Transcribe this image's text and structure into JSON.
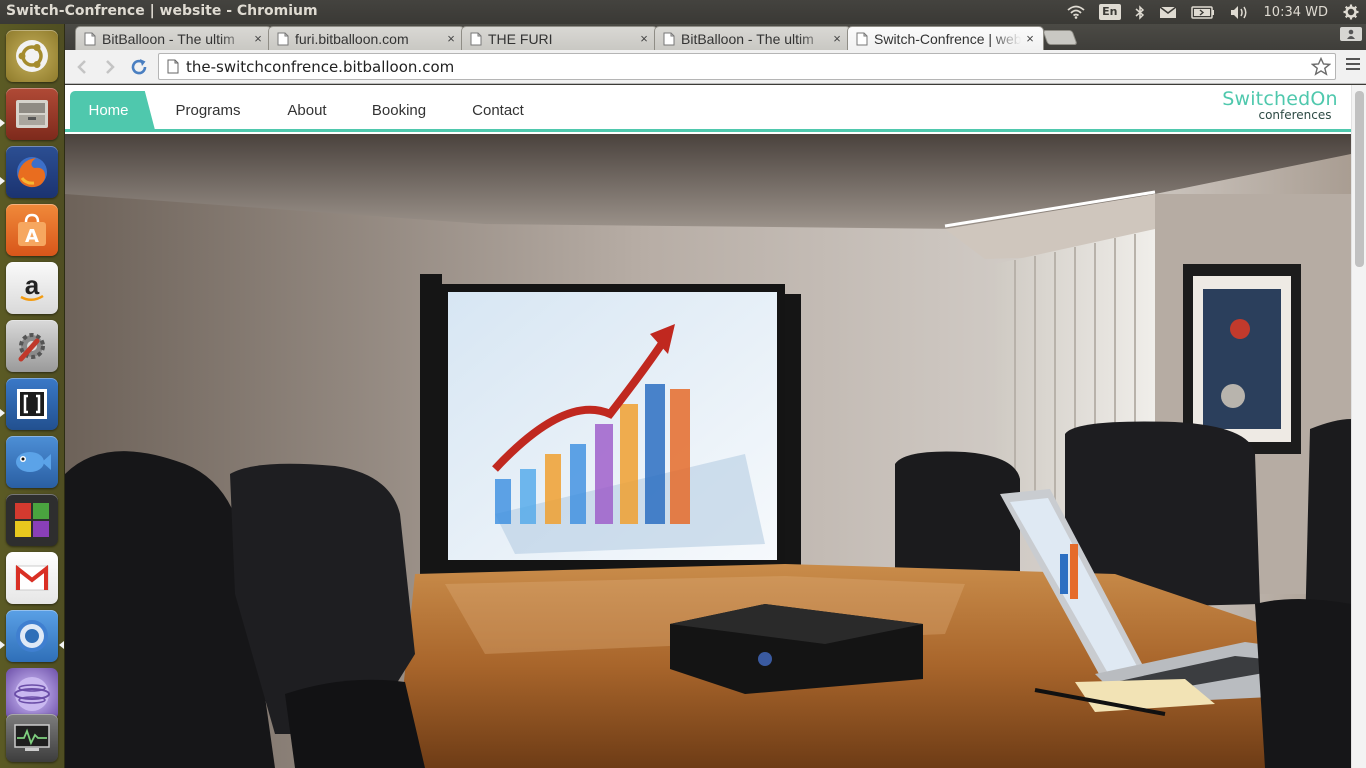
{
  "top_panel": {
    "window_title": "Switch-Confrence | website - Chromium",
    "keyboard_layout": "En",
    "clock": "10:34 WD",
    "indicators": [
      "wifi-icon",
      "bluetooth-icon",
      "mail-icon",
      "battery-icon",
      "volume-icon",
      "power-gear-icon"
    ]
  },
  "launcher": {
    "items": [
      {
        "name": "ubuntu-dash-icon"
      },
      {
        "name": "files-icon"
      },
      {
        "name": "firefox-icon"
      },
      {
        "name": "software-center-icon"
      },
      {
        "name": "amazon-icon"
      },
      {
        "name": "system-settings-icon"
      },
      {
        "name": "brackets-icon"
      },
      {
        "name": "fish-app-icon"
      },
      {
        "name": "workspaces-icon"
      },
      {
        "name": "gmail-icon"
      },
      {
        "name": "chromium-icon"
      },
      {
        "name": "orb-app-icon"
      },
      {
        "name": "system-monitor-icon"
      }
    ]
  },
  "browser": {
    "tabs": [
      {
        "title": "BitBalloon - The ultim",
        "active": false
      },
      {
        "title": "furi.bitballoon.com",
        "active": false
      },
      {
        "title": "THE FURI",
        "active": false
      },
      {
        "title": "BitBalloon - The ultim",
        "active": false
      },
      {
        "title": "Switch-Confrence | web",
        "active": true
      }
    ],
    "close_glyph": "×",
    "url": "the-switchconfrence.bitballoon.com"
  },
  "site": {
    "nav": [
      {
        "label": "Home",
        "active": true
      },
      {
        "label": "Programs",
        "active": false
      },
      {
        "label": "About",
        "active": false
      },
      {
        "label": "Booking",
        "active": false
      },
      {
        "label": "Contact",
        "active": false
      }
    ],
    "logo_main": "SwitchedOn",
    "logo_sub": "conferences",
    "accent_color": "#4fc8ad"
  }
}
